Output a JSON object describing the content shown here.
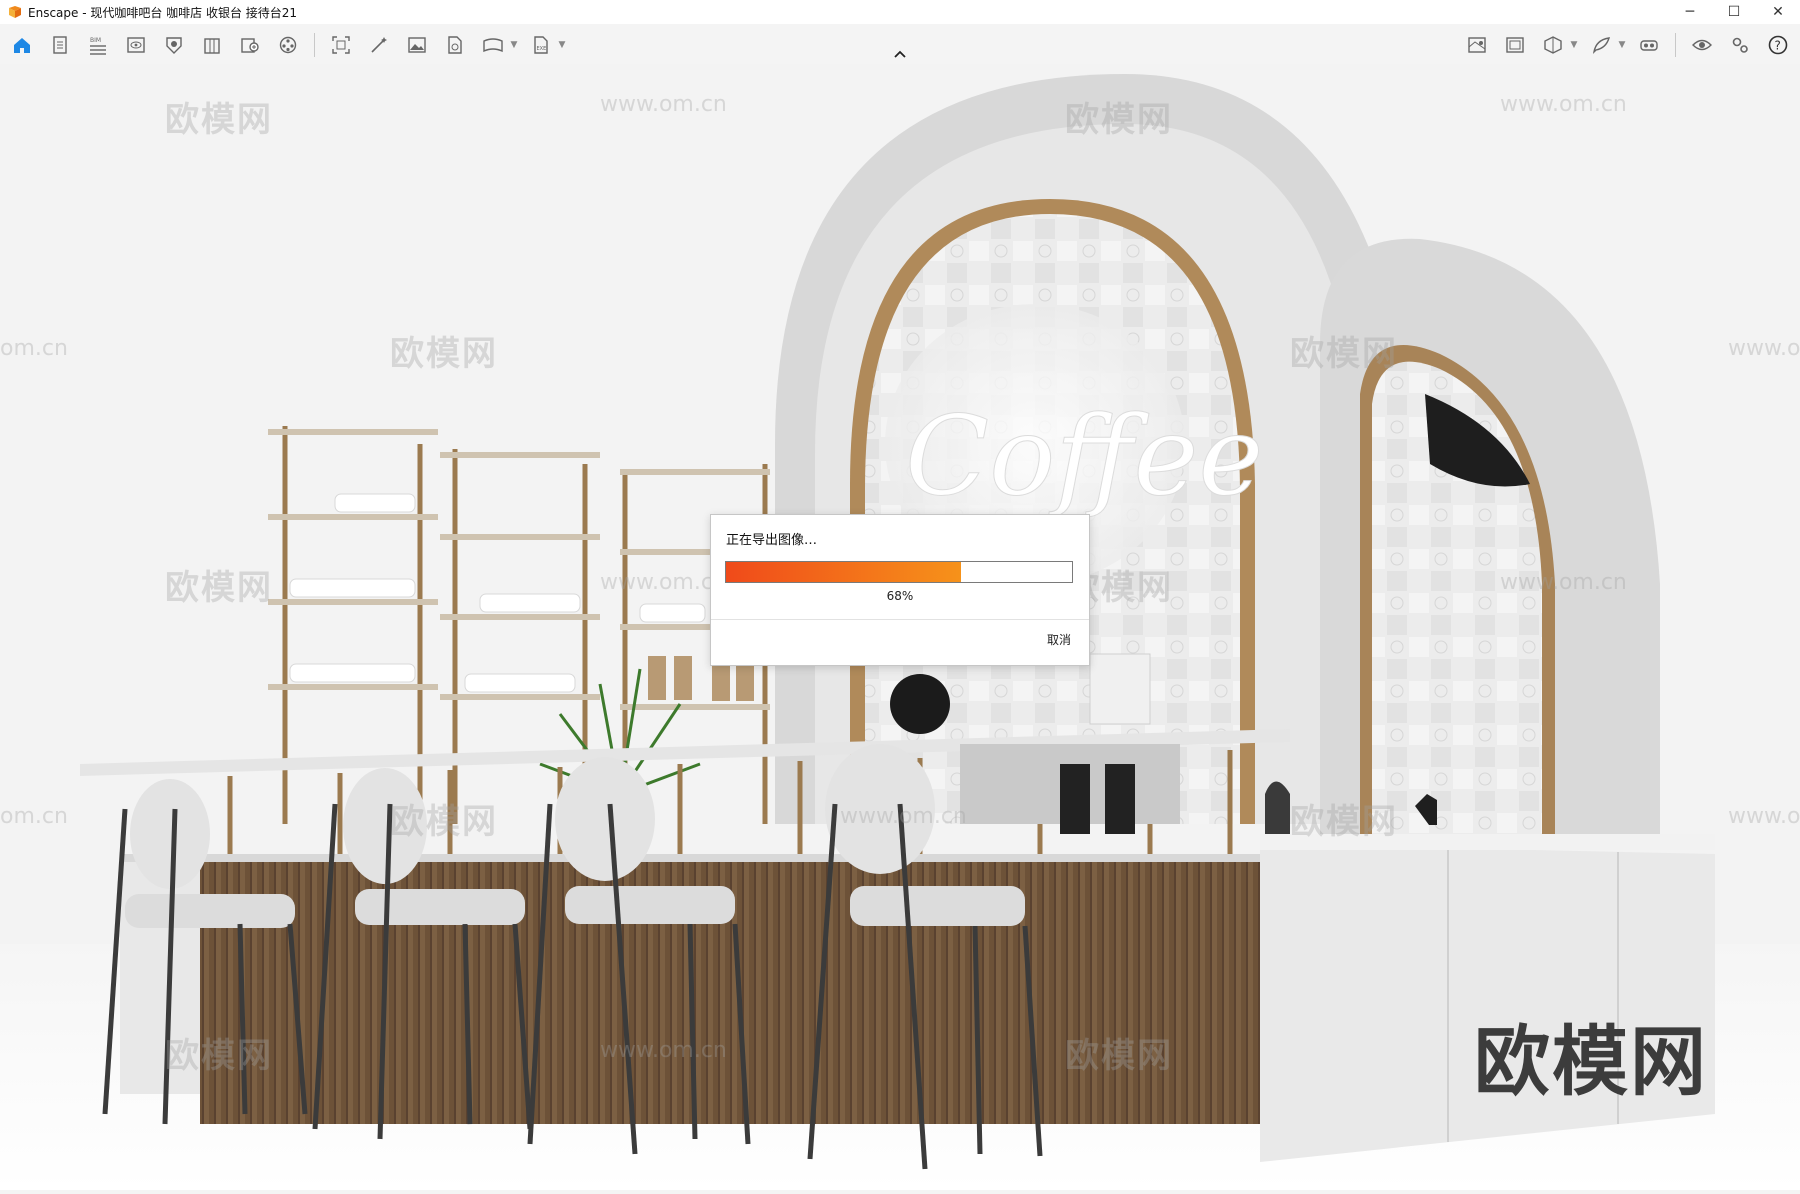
{
  "window": {
    "title": "Enscape - 现代咖啡吧台 咖啡店 收银台 接待台21",
    "controls": {
      "minimize": "─",
      "maximize": "☐",
      "close": "✕"
    }
  },
  "toolbar": {
    "left_icons": [
      "home-icon",
      "document-icon",
      "bim-icon",
      "view-icon",
      "material-icon",
      "building-icon",
      "asset-library-icon",
      "video-editor-icon",
      "screenshot-icon",
      "magic-wand-icon",
      "image-icon",
      "export-file-icon",
      "panorama-icon",
      "exe-export-icon"
    ],
    "right_icons": [
      "map-icon",
      "image-gallery-icon",
      "cube-view-icon",
      "feather-icon",
      "vr-headset-icon",
      "eye-icon",
      "settings-icon",
      "help-icon"
    ]
  },
  "dialog": {
    "title": "正在导出图像…",
    "progress": 0.68,
    "percent_label": "68%",
    "cancel_label": "取消",
    "colors": {
      "progress_start": "#f04a1a",
      "progress_end": "#f6921a"
    }
  },
  "watermarks": {
    "brand": "欧模网",
    "url": "www.om.cn",
    "url_partial": "om.cn",
    "url_partial_right": "www.o"
  },
  "accent": "#1e88e5"
}
